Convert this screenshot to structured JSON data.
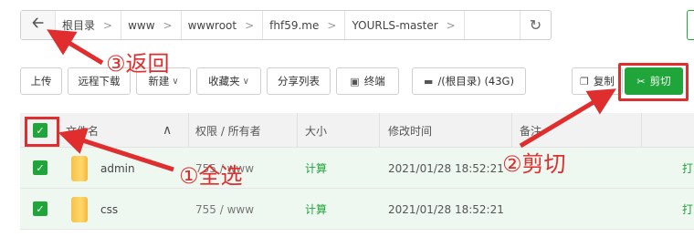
{
  "breadcrumb": {
    "items": [
      "根目录",
      "www",
      "wwwroot",
      "fhf59.me",
      "YOURLS-master"
    ]
  },
  "toolbar": {
    "upload": "上传",
    "remote_download": "远程下载",
    "new": "新建",
    "favorites": "收藏夹",
    "share_list": "分享列表",
    "terminal": "终端",
    "disk": "/(根目录) (43G)",
    "copy": "复制",
    "cut": "剪切"
  },
  "table": {
    "columns": [
      "文件名",
      "权限 / 所有者",
      "大小",
      "修改时间",
      "备注"
    ],
    "rows": [
      {
        "name": "admin",
        "perm": "755 / www",
        "size": "计算",
        "mtime": "2021/01/28 18:52:21",
        "action": "打"
      },
      {
        "name": "css",
        "perm": "755 / www",
        "size": "计算",
        "mtime": "2021/01/28 18:52:21",
        "action": "打"
      }
    ]
  },
  "annotations": {
    "select_all": "①全选",
    "cut": "②剪切",
    "back": "③返回"
  },
  "colors": {
    "accent_green": "#20a53a",
    "annotation_red": "#e02d2d",
    "selected_row": "#eef7f0"
  }
}
